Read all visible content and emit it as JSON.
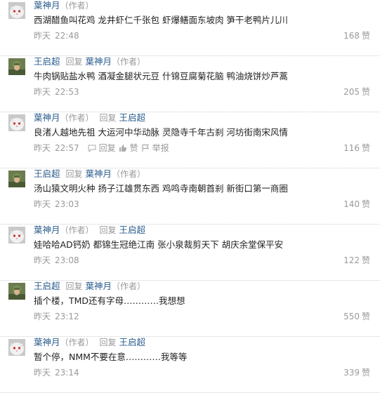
{
  "role_tag": "（作者）",
  "reply_word": "回复",
  "yesterday": "昨天",
  "like_unit": "赞",
  "action_labels": {
    "reply": "回复",
    "like": "赞",
    "report": "举报"
  },
  "comments": [
    {
      "author": "葉神月",
      "author_role": "（作者）",
      "reply_to": "",
      "reply_to_role": "",
      "avatar": "cat-avatar",
      "content": "西湖醋鱼叫花鸡 龙井虾仁千张包 虾爆鳝面东坡肉 笋干老鸭片儿川",
      "date": "昨天",
      "time": "22:48",
      "likes": "168",
      "show_actions": false
    },
    {
      "author": "王启超",
      "author_role": "",
      "reply_to": "葉神月",
      "reply_to_role": "（作者）",
      "avatar": "soldier-avatar",
      "content": "牛肉锅贴盐水鸭 酒凝金腿状元豆 什锦豆腐菊花脑 鸭油烧饼炒芦蒿",
      "date": "昨天",
      "time": "22:53",
      "likes": "205",
      "show_actions": false
    },
    {
      "author": "葉神月",
      "author_role": "（作者）",
      "reply_to": "王启超",
      "reply_to_role": "",
      "avatar": "cat-avatar",
      "content": "良渚人越地先祖 大运河中华动脉 灵隐寺千年古刹 河坊街南宋风情",
      "date": "昨天",
      "time": "22:57",
      "likes": "116",
      "show_actions": true
    },
    {
      "author": "王启超",
      "author_role": "",
      "reply_to": "葉神月",
      "reply_to_role": "（作者）",
      "avatar": "soldier-avatar",
      "content": "汤山猿文明火种 扬子江雄贯东西 鸡鸣寺南朝首刹 新街口第一商圈",
      "date": "昨天",
      "time": "23:03",
      "likes": "140",
      "show_actions": false
    },
    {
      "author": "葉神月",
      "author_role": "（作者）",
      "reply_to": "王启超",
      "reply_to_role": "",
      "avatar": "cat-avatar",
      "content": "娃哈哈AD钙奶 都锦生冠绝江南 张小泉裁剪天下 胡庆余堂保平安",
      "date": "昨天",
      "time": "23:08",
      "likes": "122",
      "show_actions": false
    },
    {
      "author": "王启超",
      "author_role": "",
      "reply_to": "葉神月",
      "reply_to_role": "（作者）",
      "avatar": "soldier-avatar",
      "content": "插个楼，TMD还有字母…………我想想",
      "date": "昨天",
      "time": "23:12",
      "likes": "550",
      "show_actions": false
    },
    {
      "author": "葉神月",
      "author_role": "（作者）",
      "reply_to": "王启超",
      "reply_to_role": "",
      "avatar": "cat-avatar",
      "content": "暂个停，NMM不要在意…………我等等",
      "date": "昨天",
      "time": "23:14",
      "likes": "339",
      "show_actions": false
    }
  ],
  "colors": {
    "username": "#2b5d8e",
    "muted": "#999999",
    "text": "#222222",
    "divider": "#cfcfcf"
  }
}
